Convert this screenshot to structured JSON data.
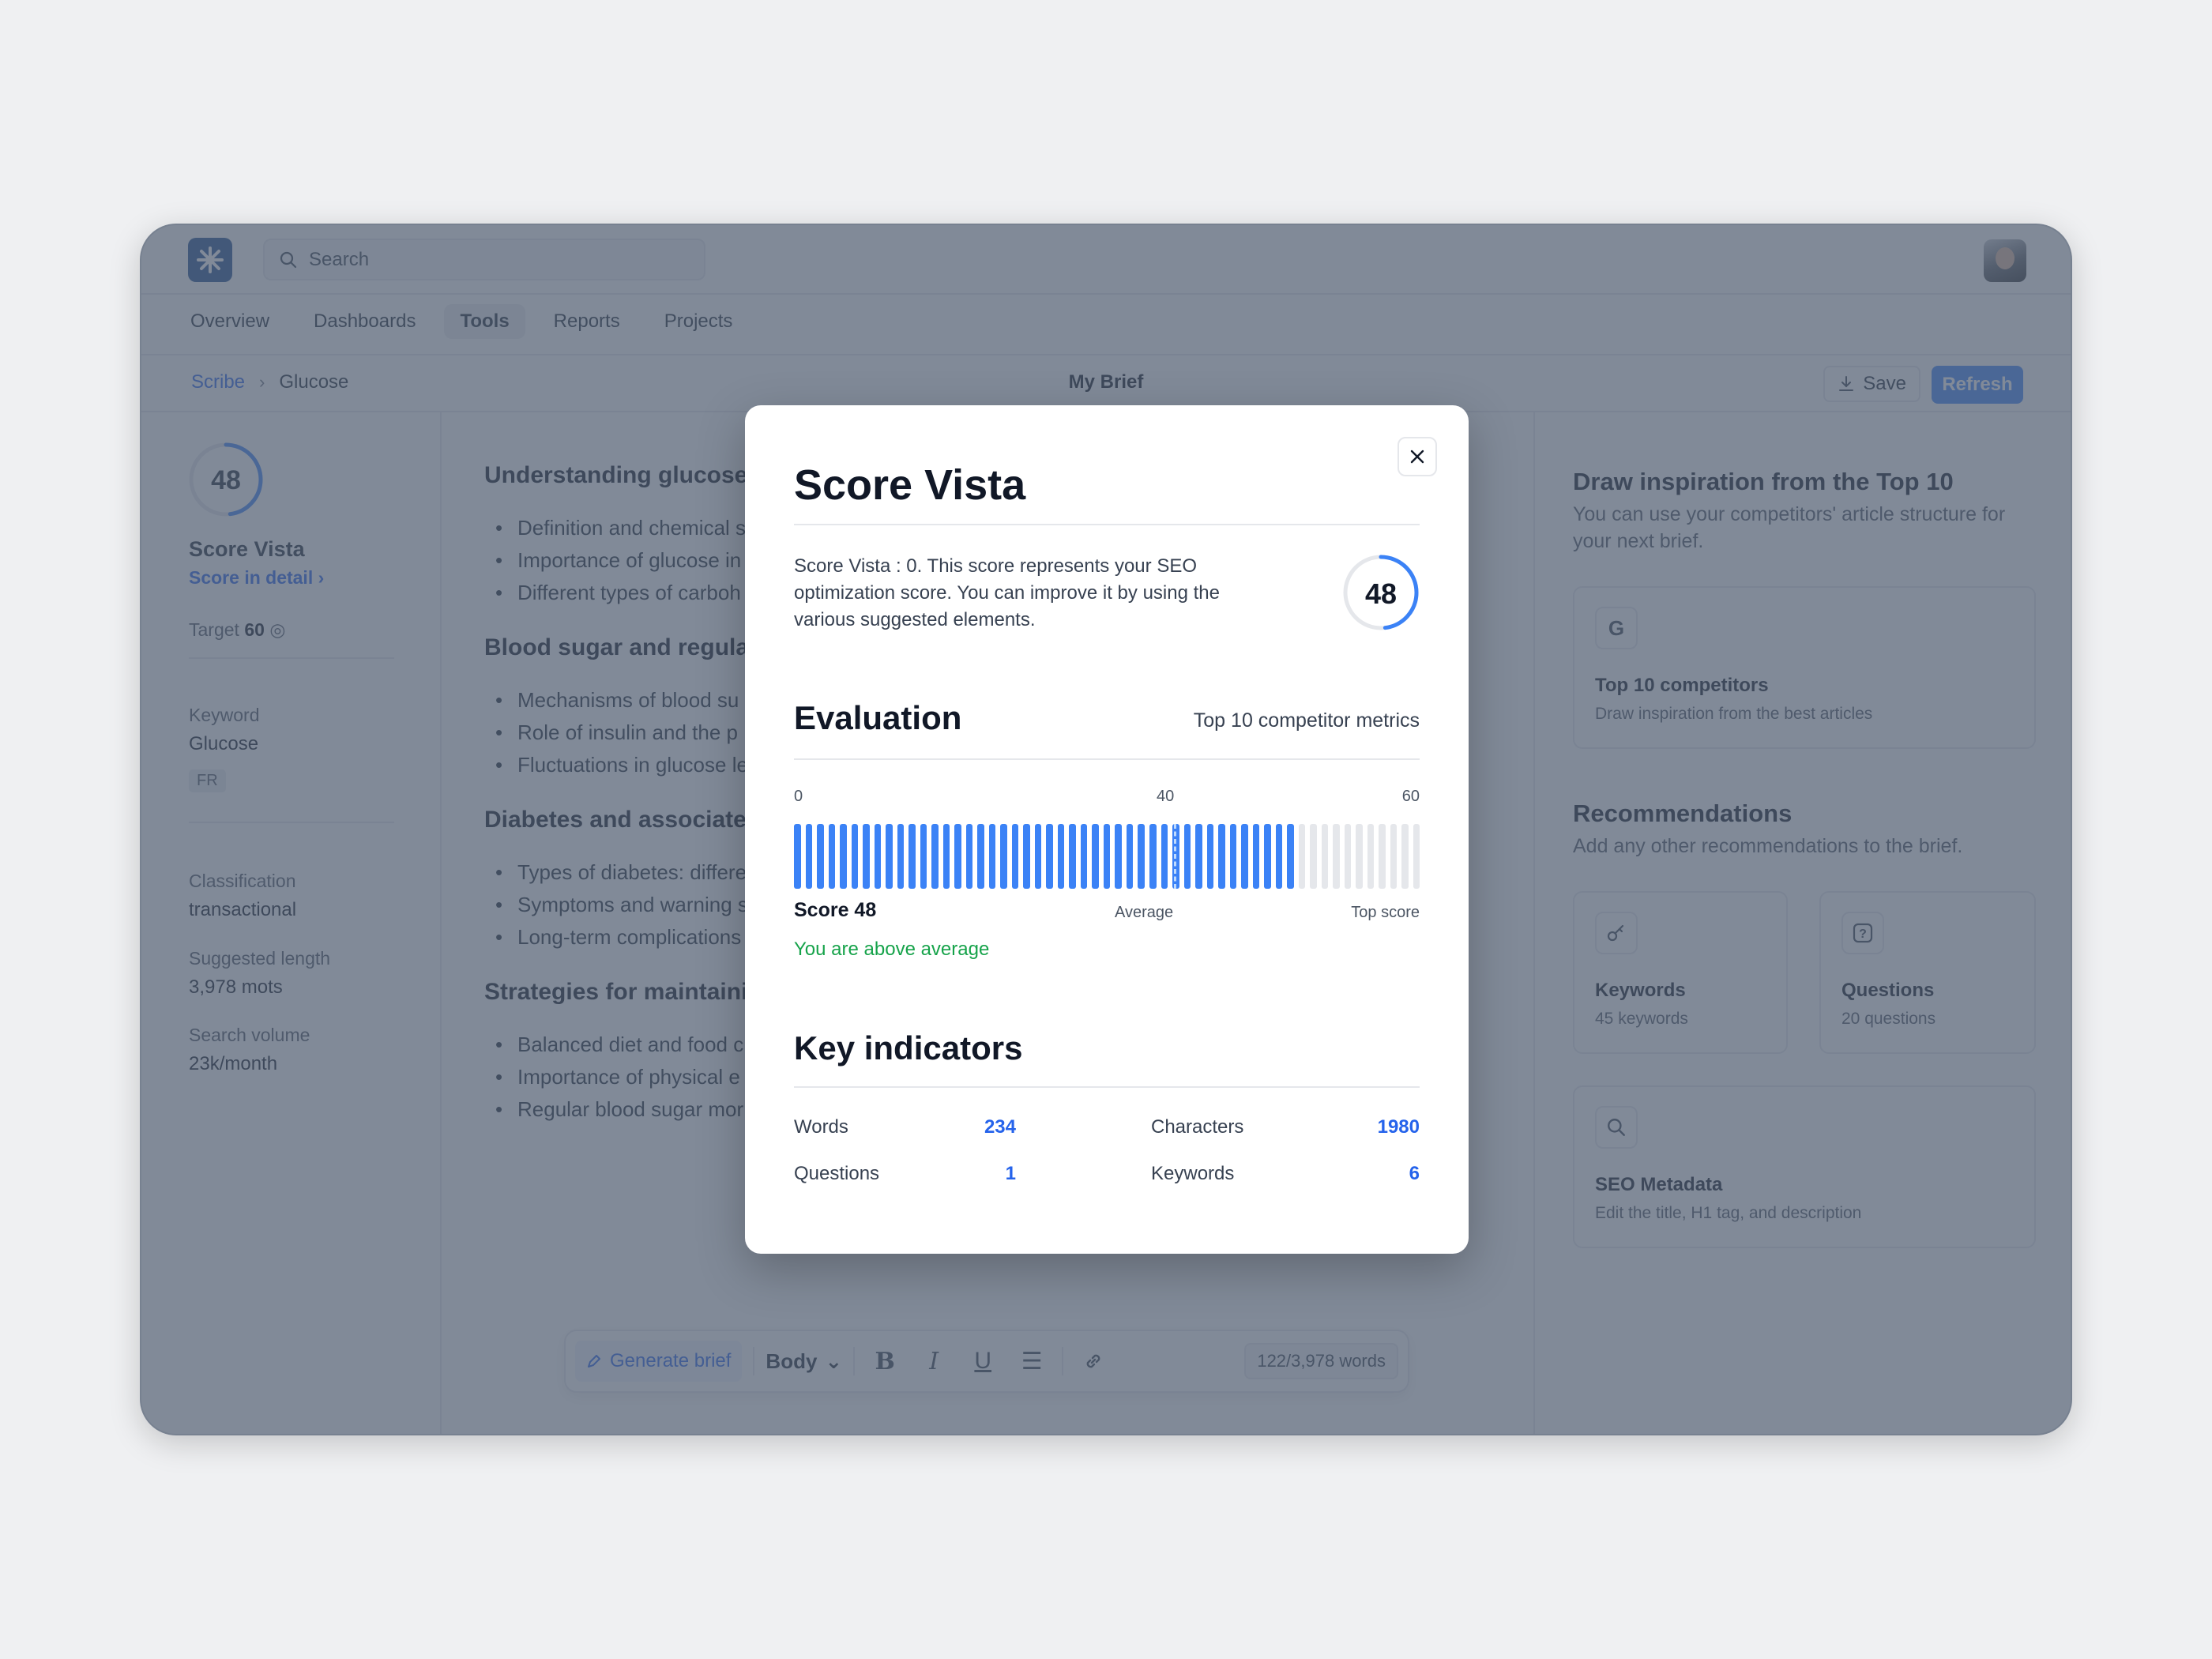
{
  "topbar": {
    "search_placeholder": "Search"
  },
  "nav": [
    "Overview",
    "Dashboards",
    "Tools",
    "Reports",
    "Projects"
  ],
  "breadcrumb": {
    "root": "Scribe",
    "current": "Glucose"
  },
  "page_title": "My Brief",
  "actions": {
    "save": "Save",
    "refresh": "Refresh"
  },
  "left": {
    "score": "48",
    "score_fraction": 0.48,
    "title": "Score Vista",
    "detail_link": "Score in detail",
    "target_label": "Target",
    "target_value": "60",
    "keyword_label": "Keyword",
    "keyword_value": "Glucose",
    "lang_badge": "FR",
    "classification_label": "Classification",
    "classification_value": "transactional",
    "length_label": "Suggested length",
    "length_value": "3,978 mots",
    "volume_label": "Search volume",
    "volume_value": "23k/month"
  },
  "editor": {
    "sections": [
      {
        "heading": "Understanding glucose",
        "items": [
          "Definition and chemical s",
          "Importance of glucose in",
          "Different types of carboh"
        ]
      },
      {
        "heading": "Blood sugar and regula",
        "items": [
          "Mechanisms of blood su",
          "Role of insulin and the p",
          "Fluctuations in glucose le"
        ]
      },
      {
        "heading": "Diabetes and associate",
        "items": [
          "Types of diabetes: differe",
          "Symptoms and warning s",
          "Long-term complications"
        ]
      },
      {
        "heading": "Strategies for maintaini",
        "items": [
          "Balanced diet and food c",
          "Importance of physical e",
          "Regular blood sugar mor"
        ]
      }
    ]
  },
  "toolbar": {
    "generate": "Generate brief",
    "style": "Body",
    "word_count": "122/3,978 words"
  },
  "right": {
    "inspiration_title": "Draw inspiration from the Top 10",
    "inspiration_desc": "You can use your competitors' article structure for your next brief.",
    "competitors_title": "Top 10 competitors",
    "competitors_desc": "Draw inspiration from the best articles",
    "rec_title": "Recommendations",
    "rec_desc": "Add any other recommendations to the brief.",
    "keywords_title": "Keywords",
    "keywords_desc": "45 keywords",
    "questions_title": "Questions",
    "questions_desc": "20 questions",
    "seo_title": "SEO Metadata",
    "seo_desc": "Edit the title, H1 tag, and description"
  },
  "modal": {
    "title": "Score Vista",
    "description": "Score Vista : 0. This score represents your SEO optimization score. You can improve it by using the various suggested elements.",
    "score": "48",
    "evaluation_title": "Evaluation",
    "evaluation_sub": "Top 10 competitor metrics",
    "tick_min": "0",
    "tick_avg": "40",
    "tick_max": "60",
    "score_value": 48,
    "scale_max": 60,
    "score_label": "Score 48",
    "average_label": "Average",
    "top_label": "Top score",
    "status": "You are above average",
    "indicators_title": "Key indicators",
    "words_label": "Words",
    "words_value": "234",
    "characters_label": "Characters",
    "characters_value": "1980",
    "questions_label": "Questions",
    "questions_value": "1",
    "keywords_label": "Keywords",
    "keywords_value": "6"
  },
  "colors": {
    "accent": "#3b82f6",
    "success": "#16a34a",
    "logo": "#1e4d8f",
    "overlay": "#505d70"
  }
}
